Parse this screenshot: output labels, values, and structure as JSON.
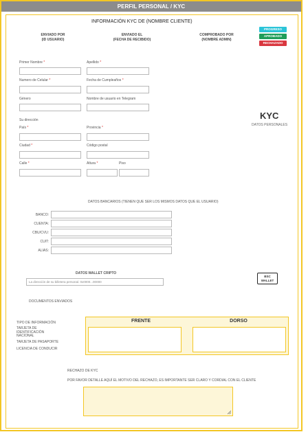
{
  "header": {
    "title": "PERFIL PERSONAL / KYC"
  },
  "kyc_info": {
    "title": "INFORMACIÓN KYC DE (NOMBRE CLIENTE)",
    "columns": [
      {
        "line1": "ENVIADO POR",
        "line2": "(ID USUARIO)"
      },
      {
        "line1": "ENVIADO EL",
        "line2": "(FECHA DE RECIBIDO)"
      },
      {
        "line1": "COMPROBADO POR",
        "line2": "(NOMBRE ADMIN)"
      }
    ],
    "statuses": [
      {
        "label": "PROGRESO",
        "color": "#2bc4d8"
      },
      {
        "label": "APROBADO",
        "color": "#1e9e5a"
      },
      {
        "label": "RECHAZADO",
        "color": "#d9373f"
      }
    ]
  },
  "personal": {
    "first_name": "Primer Nombre",
    "last_name": "Apellido",
    "phone": "Numero de Celular",
    "birthday": "Fecha de Cumpleaños",
    "gender": "Género",
    "telegram": "Nombre de usuario en Telegram",
    "address_heading": "Su dirección",
    "country": "País",
    "province": "Provincia",
    "city": "Ciudad",
    "postal": "Código postal",
    "street": "Calle",
    "height": "Altura",
    "floor": "Piso"
  },
  "kyc_side": {
    "big": "KYC",
    "sub": "DATOS PERSONALES"
  },
  "bank": {
    "title": "DATOS BANCARIOS (TIENEN QUE SER LOS MISMOS DATOS QUE EL USUARIO)",
    "fields": [
      "BANCO:",
      "CUENTA:",
      "CBU/CVU:",
      "CUIT:",
      "ALIAS:"
    ]
  },
  "wallet": {
    "title": "DATOS WALLET CRIPTO",
    "placeholder": "La dirección de su billetera personal. 0x0000...00000",
    "bsc_line1": "BSC",
    "bsc_line2": "WALLET"
  },
  "documents": {
    "title": "DOCUMENTOS ENVIADOS",
    "info_label": "TIPO DE INFORMACIÓN",
    "types": [
      "TARJETA DE IDENTIFICACIÓN NACIONAL",
      "TARJETA DE PASAPORTE",
      "LICENCIA DE CONDUCIR"
    ],
    "front": "FRENTE",
    "back": "DORSO"
  },
  "rejection": {
    "title": "RECHAZO DE KYC",
    "instructions": "POR FAVOR DETALLE AQUÍ EL MOTIVO DEL RECHAZO, ES IMPORTANTE SER CLARO Y CORDIAL CON EL CLIENTE"
  }
}
